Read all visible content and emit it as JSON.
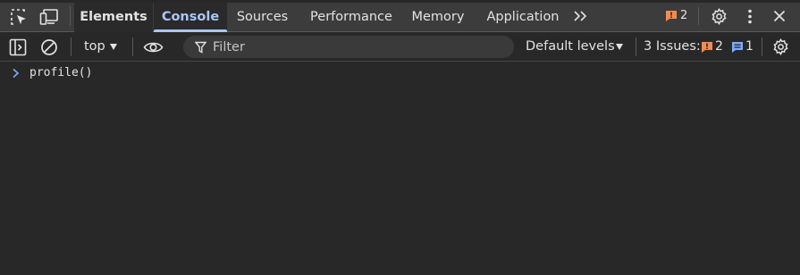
{
  "tabs": [
    {
      "label": "Elements"
    },
    {
      "label": "Console"
    },
    {
      "label": "Sources"
    },
    {
      "label": "Performance"
    },
    {
      "label": "Memory"
    },
    {
      "label": "Application"
    }
  ],
  "tabbar": {
    "active_tab": "Console",
    "icons": [
      "inspect-element-icon",
      "device-toolbar-icon",
      "more-tabs-icon",
      "issue-warning-icon",
      "settings-gear-icon",
      "kebab-menu-icon",
      "close-icon"
    ],
    "issue_count": "2"
  },
  "toolbar": {
    "icons": [
      "sidebar-toggle-icon",
      "clear-console-icon",
      "live-expression-eye-icon",
      "filter-funnel-icon",
      "warning-issue-icon",
      "info-issue-icon",
      "console-settings-gear-icon"
    ],
    "context": "top",
    "filter_placeholder": "Filter",
    "filter_value": "",
    "levels": "Default levels",
    "issues_label": "3 Issues:",
    "warning_count": "2",
    "info_count": "1"
  },
  "console": {
    "lines": [
      {
        "type": "input",
        "text": "profile()"
      }
    ]
  },
  "colors": {
    "background": "#282828",
    "tabbar_background": "#3c3c3c",
    "active_tab_accent": "#a8c7fa",
    "warning": "#f28b54",
    "info": "#7cacf8",
    "text": "#e3e3e3"
  }
}
